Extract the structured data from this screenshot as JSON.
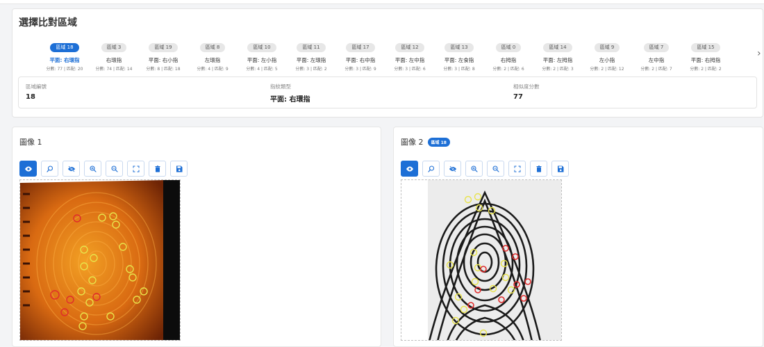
{
  "header": {
    "title": "選擇比對區域"
  },
  "tabs": [
    {
      "chip": "區域 18",
      "name": "平面: 右環指",
      "meta": "分數: 77 | 匹配: 20",
      "active": true
    },
    {
      "chip": "區域 3",
      "name": "右環指",
      "meta": "分數: 74 | 匹配: 14"
    },
    {
      "chip": "區域 19",
      "name": "平面: 右小指",
      "meta": "分數: 8 | 匹配: 18"
    },
    {
      "chip": "區域 8",
      "name": "左環指",
      "meta": "分數: 4 | 匹配: 9"
    },
    {
      "chip": "區域 10",
      "name": "平面: 左小指",
      "meta": "分數: 4 | 匹配: 5"
    },
    {
      "chip": "區域 11",
      "name": "平面: 左環指",
      "meta": "分數: 3 | 匹配: 2"
    },
    {
      "chip": "區域 17",
      "name": "平面: 右中指",
      "meta": "分數: 3 | 匹配: 9"
    },
    {
      "chip": "區域 12",
      "name": "平面: 左中指",
      "meta": "分數: 3 | 匹配: 6"
    },
    {
      "chip": "區域 13",
      "name": "平面: 左食指",
      "meta": "分數: 3 | 匹配: 8"
    },
    {
      "chip": "區域 0",
      "name": "右拇指",
      "meta": "分數: 2 | 匹配: 6"
    },
    {
      "chip": "區域 14",
      "name": "平面: 左拇指",
      "meta": "分數: 2 | 匹配: 3"
    },
    {
      "chip": "區域 9",
      "name": "左小指",
      "meta": "分數: 2 | 匹配: 12"
    },
    {
      "chip": "區域 7",
      "name": "左中指",
      "meta": "分數: 2 | 匹配: 7"
    },
    {
      "chip": "區域 15",
      "name": "平面: 右拇指",
      "meta": "分數: 2 | 匹配: 2"
    }
  ],
  "info": {
    "region_label": "區域編號",
    "region_value": "18",
    "type_label": "指紋類型",
    "type_value": "平面: 右環指",
    "score_label": "相似度分數",
    "score_value": "77"
  },
  "panel1": {
    "title": "圖像 1"
  },
  "panel2": {
    "title": "圖像 2",
    "badge": "區域 18"
  },
  "toolbar_icons": [
    "eye-icon",
    "zoom-search-icon",
    "eye-off-icon",
    "zoom-in-icon",
    "zoom-out-icon",
    "fit-screen-icon",
    "delete-icon",
    "save-icon"
  ],
  "colors": {
    "accent": "#1d6fd6",
    "minutia_match": "#e8e34a",
    "minutia_unmatched": "#e02b2b"
  }
}
